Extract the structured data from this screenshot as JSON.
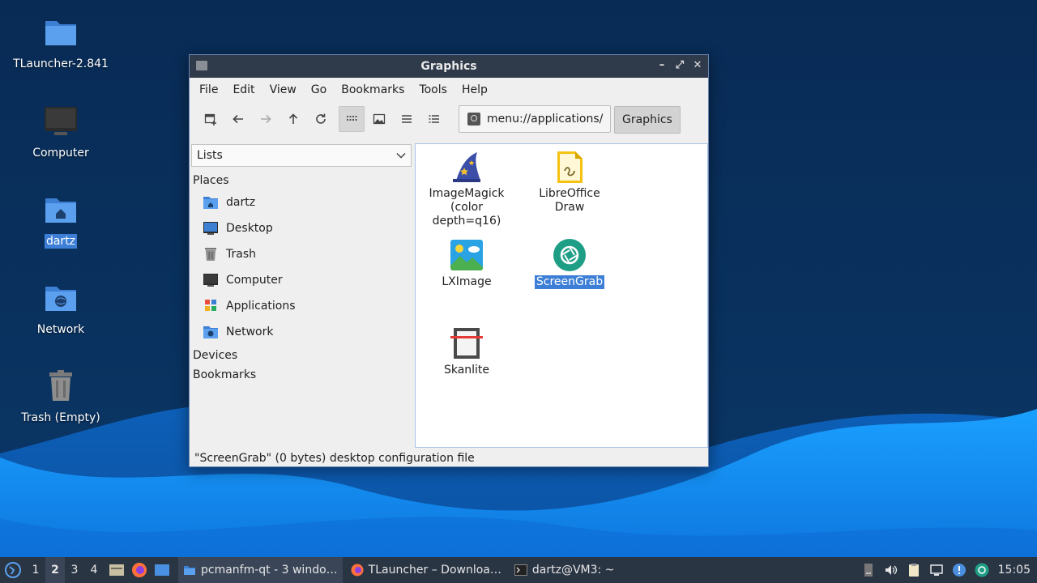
{
  "desktop": {
    "icons": [
      {
        "label": "TLauncher-2.841"
      },
      {
        "label": "Computer"
      },
      {
        "label": "dartz"
      },
      {
        "label": "Network"
      },
      {
        "label": "Trash (Empty)"
      }
    ]
  },
  "window": {
    "title": "Graphics",
    "menu": [
      "File",
      "Edit",
      "View",
      "Go",
      "Bookmarks",
      "Tools",
      "Help"
    ],
    "address": "menu://applications/",
    "breadcrumb": "Graphics",
    "sidebar": {
      "selector": "Lists",
      "places_label": "Places",
      "places": [
        {
          "label": "dartz",
          "icon": "home-folder-icon"
        },
        {
          "label": "Desktop",
          "icon": "desktop-icon"
        },
        {
          "label": "Trash",
          "icon": "trash-icon"
        },
        {
          "label": "Computer",
          "icon": "computer-icon"
        },
        {
          "label": "Applications",
          "icon": "applications-icon"
        },
        {
          "label": "Network",
          "icon": "network-folder-icon"
        }
      ],
      "devices_label": "Devices",
      "bookmarks_label": "Bookmarks"
    },
    "files": [
      {
        "label": "ImageMagick (color depth=q16)",
        "icon": "imagemagick-icon"
      },
      {
        "label": "LibreOffice Draw",
        "icon": "libreoffice-draw-icon"
      },
      {
        "label": "LXImage",
        "icon": "lximage-icon"
      },
      {
        "label": "ScreenGrab",
        "icon": "screengrab-icon",
        "selected": true
      },
      {
        "label": "Skanlite",
        "icon": "skanlite-icon"
      }
    ],
    "status": "\"ScreenGrab\" (0 bytes) desktop configuration file"
  },
  "taskbar": {
    "workspaces": [
      "1",
      "2",
      "3",
      "4"
    ],
    "active_workspace": "2",
    "tasks": [
      {
        "label": "pcmanfm-qt - 3 windo…",
        "icon": "folder-icon"
      },
      {
        "label": "TLauncher – Downloa…",
        "icon": "firefox-icon"
      },
      {
        "label": "dartz@VM3: ~",
        "icon": "terminal-icon"
      }
    ],
    "clock": "15:05"
  },
  "colors": {
    "selection": "#3d7fd6",
    "titlebar": "#2f3a4a",
    "taskbar": "#2a3544",
    "wallpaper_dark": "#072a52",
    "wallpaper_wave": "#1f8ef0"
  }
}
